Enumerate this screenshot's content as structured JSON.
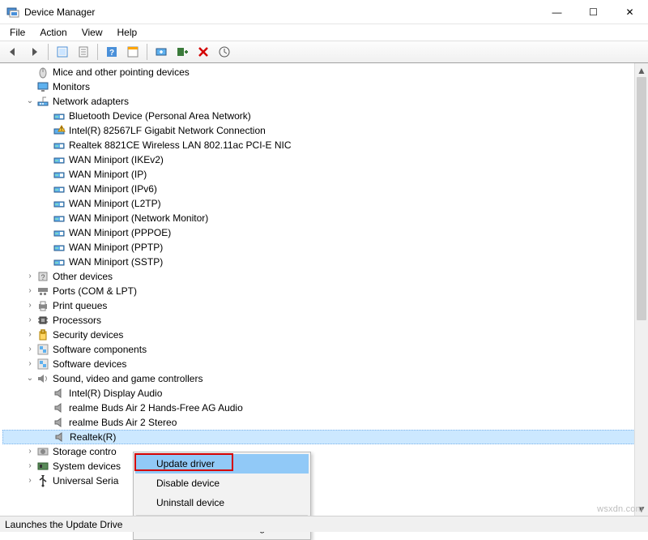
{
  "window": {
    "title": "Device Manager"
  },
  "winbtns": {
    "min": "—",
    "max": "☐",
    "close": "✕"
  },
  "menubar": [
    "File",
    "Action",
    "View",
    "Help"
  ],
  "toolbar_icons": [
    "back",
    "forward",
    "show-hidden",
    "properties",
    "help",
    "details",
    "update-driver",
    "scan-hardware",
    "uninstall",
    "view-options"
  ],
  "tree": [
    {
      "d": 1,
      "exp": "",
      "icon": "mouse-icon",
      "label": "Mice and other pointing devices"
    },
    {
      "d": 1,
      "exp": "",
      "icon": "monitor-icon",
      "label": "Monitors"
    },
    {
      "d": 1,
      "exp": "open",
      "icon": "network-icon",
      "label": "Network adapters"
    },
    {
      "d": 2,
      "exp": "",
      "icon": "nic-icon",
      "label": "Bluetooth Device (Personal Area Network)"
    },
    {
      "d": 2,
      "exp": "",
      "icon": "nic-warn-icon",
      "label": "Intel(R) 82567LF Gigabit Network Connection"
    },
    {
      "d": 2,
      "exp": "",
      "icon": "nic-icon",
      "label": "Realtek 8821CE Wireless LAN 802.11ac PCI-E NIC"
    },
    {
      "d": 2,
      "exp": "",
      "icon": "nic-icon",
      "label": "WAN Miniport (IKEv2)"
    },
    {
      "d": 2,
      "exp": "",
      "icon": "nic-icon",
      "label": "WAN Miniport (IP)"
    },
    {
      "d": 2,
      "exp": "",
      "icon": "nic-icon",
      "label": "WAN Miniport (IPv6)"
    },
    {
      "d": 2,
      "exp": "",
      "icon": "nic-icon",
      "label": "WAN Miniport (L2TP)"
    },
    {
      "d": 2,
      "exp": "",
      "icon": "nic-icon",
      "label": "WAN Miniport (Network Monitor)"
    },
    {
      "d": 2,
      "exp": "",
      "icon": "nic-icon",
      "label": "WAN Miniport (PPPOE)"
    },
    {
      "d": 2,
      "exp": "",
      "icon": "nic-icon",
      "label": "WAN Miniport (PPTP)"
    },
    {
      "d": 2,
      "exp": "",
      "icon": "nic-icon",
      "label": "WAN Miniport (SSTP)"
    },
    {
      "d": 1,
      "exp": "closed",
      "icon": "other-icon",
      "label": "Other devices"
    },
    {
      "d": 1,
      "exp": "closed",
      "icon": "ports-icon",
      "label": "Ports (COM & LPT)"
    },
    {
      "d": 1,
      "exp": "closed",
      "icon": "printer-icon",
      "label": "Print queues"
    },
    {
      "d": 1,
      "exp": "closed",
      "icon": "cpu-icon",
      "label": "Processors"
    },
    {
      "d": 1,
      "exp": "closed",
      "icon": "security-icon",
      "label": "Security devices"
    },
    {
      "d": 1,
      "exp": "closed",
      "icon": "sw-icon",
      "label": "Software components"
    },
    {
      "d": 1,
      "exp": "closed",
      "icon": "sw-icon",
      "label": "Software devices"
    },
    {
      "d": 1,
      "exp": "open",
      "icon": "sound-icon",
      "label": "Sound, video and game controllers"
    },
    {
      "d": 2,
      "exp": "",
      "icon": "speaker-icon",
      "label": "Intel(R) Display Audio"
    },
    {
      "d": 2,
      "exp": "",
      "icon": "speaker-icon",
      "label": "realme Buds Air 2 Hands-Free AG Audio"
    },
    {
      "d": 2,
      "exp": "",
      "icon": "speaker-icon",
      "label": "realme Buds Air 2 Stereo"
    },
    {
      "d": 2,
      "exp": "",
      "icon": "speaker-icon",
      "label": "Realtek(R) ",
      "selected": true
    },
    {
      "d": 1,
      "exp": "closed",
      "icon": "storage-icon",
      "label": "Storage contro"
    },
    {
      "d": 1,
      "exp": "closed",
      "icon": "system-icon",
      "label": "System devices"
    },
    {
      "d": 1,
      "exp": "closed",
      "icon": "usb-icon",
      "label": "Universal Seria"
    }
  ],
  "context_menu": {
    "items": [
      {
        "label": "Update driver",
        "hover": true
      },
      {
        "label": "Disable device"
      },
      {
        "label": "Uninstall device"
      },
      {
        "sep": true
      },
      {
        "label": "Scan for hardware changes"
      }
    ]
  },
  "statusbar": "Launches the Update Drive",
  "watermark": "wsxdn.com"
}
